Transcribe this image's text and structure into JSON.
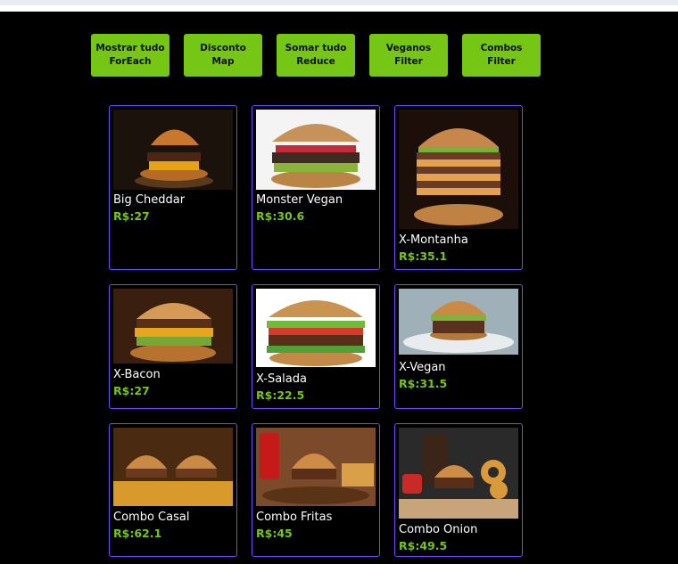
{
  "buttons": [
    {
      "line1": "Mostrar tudo",
      "line2": "ForEach"
    },
    {
      "line1": "Disconto",
      "line2": "Map"
    },
    {
      "line1": "Somar tudo",
      "line2": "Reduce"
    },
    {
      "line1": "Veganos",
      "line2": "Filter"
    },
    {
      "line1": "Combos",
      "line2": "Filter"
    }
  ],
  "products": [
    {
      "name": "Big Cheddar",
      "price": "R$:27"
    },
    {
      "name": "Monster Vegan",
      "price": "R$:30.6"
    },
    {
      "name": "X-Montanha",
      "price": "R$:35.1"
    },
    {
      "name": "X-Bacon",
      "price": "R$:27"
    },
    {
      "name": "X-Salada",
      "price": "R$:22.5"
    },
    {
      "name": "X-Vegan",
      "price": "R$:31.5"
    },
    {
      "name": "Combo Casal",
      "price": "R$:62.1"
    },
    {
      "name": "Combo Fritas",
      "price": "R$:45"
    },
    {
      "name": "Combo Onion",
      "price": "R$:49.5"
    }
  ],
  "colors": {
    "accent": "#76c615",
    "card_border": "#7b44ff",
    "background": "#000000"
  },
  "icons": [
    "burger-photo"
  ]
}
